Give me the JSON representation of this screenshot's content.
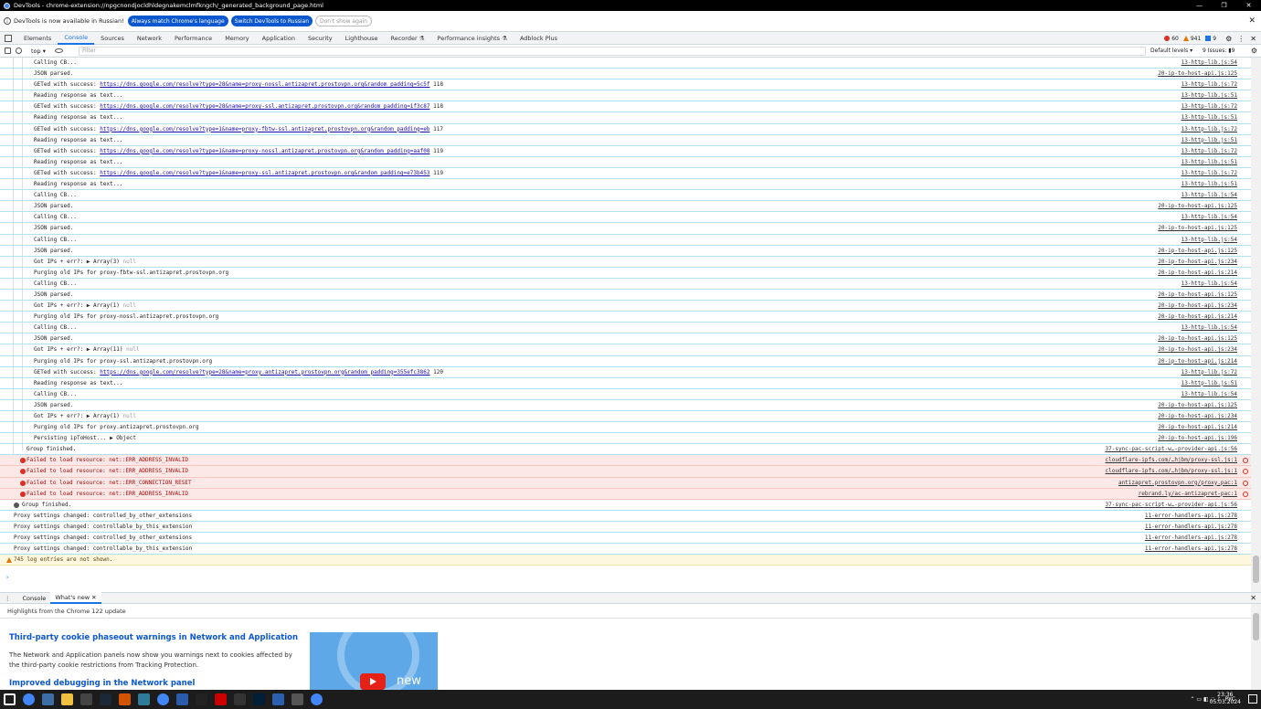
{
  "window": {
    "title": "DevTools - chrome-extension://npgcnondjocldhldegnakemclmfkngch/_generated_background_page.html",
    "min": "—",
    "max": "❐",
    "close": "✕"
  },
  "infobar": {
    "message": "DevTools is now available in Russian!",
    "btn_match": "Always match Chrome's language",
    "btn_switch": "Switch DevTools to Russian",
    "btn_dismiss": "Don't show again",
    "close": "✕"
  },
  "tabs": [
    "Elements",
    "Console",
    "Sources",
    "Network",
    "Performance",
    "Memory",
    "Application",
    "Security",
    "Lighthouse",
    "Recorder ⚗",
    "Performance insights ⚗",
    "Adblock Plus"
  ],
  "active_tab": "Console",
  "status": {
    "errors": "60",
    "warnings": "941",
    "info": "9"
  },
  "toolbar": {
    "context": "top ▾",
    "filter_placeholder": "Filter",
    "levels": "Default levels ▾",
    "issues": "9 Issues: ▮9"
  },
  "console_rows": [
    {
      "indent": 37,
      "msg": "Calling CB...",
      "src": "13-http-lib.js:54"
    },
    {
      "indent": 37,
      "msg": "JSON parsed.",
      "src": "20-ip-to-host-api.js:125"
    },
    {
      "indent": 37,
      "msg": "GETed with success: ",
      "link": "https://dns.google.com/resolve?type=28&name=proxy-nossl.antizapret.prostovpn.org&random_padding=5c5f",
      "tail": " 118",
      "src": "13-http-lib.js:72"
    },
    {
      "indent": 37,
      "msg": "Reading response as text...",
      "src": "13-http-lib.js:51"
    },
    {
      "indent": 37,
      "msg": "GETed with success: ",
      "link": "https://dns.google.com/resolve?type=28&name=proxy-ssl.antizapret.prostovpn.org&random_padding=1f3c87",
      "tail": " 118",
      "src": "13-http-lib.js:72"
    },
    {
      "indent": 37,
      "msg": "Reading response as text...",
      "src": "13-http-lib.js:51"
    },
    {
      "indent": 37,
      "msg": "GETed with success: ",
      "link": "https://dns.google.com/resolve?type=1&name=proxy-fbtw-ssl.antizapret.prostovpn.org&random_padding=eb",
      "tail": " 117",
      "src": "13-http-lib.js:72"
    },
    {
      "indent": 37,
      "msg": "Reading response as text...",
      "src": "13-http-lib.js:51"
    },
    {
      "indent": 37,
      "msg": "GETed with success: ",
      "link": "https://dns.google.com/resolve?type=1&name=proxy-nossl.antizapret.prostovpn.org&random_padding=aaf08",
      "tail": " 119",
      "src": "13-http-lib.js:72"
    },
    {
      "indent": 37,
      "msg": "Reading response as text...",
      "src": "13-http-lib.js:51"
    },
    {
      "indent": 37,
      "msg": "GETed with success: ",
      "link": "https://dns.google.com/resolve?type=1&name=proxy-ssl.antizapret.prostovpn.org&random_padding=e73b453",
      "tail": " 119",
      "src": "13-http-lib.js:72"
    },
    {
      "indent": 37,
      "msg": "Reading response as text...",
      "src": "13-http-lib.js:51"
    },
    {
      "indent": 37,
      "msg": "Calling CB...",
      "src": "13-http-lib.js:54"
    },
    {
      "indent": 37,
      "msg": "JSON parsed.",
      "src": "20-ip-to-host-api.js:125"
    },
    {
      "indent": 37,
      "msg": "Calling CB...",
      "src": "13-http-lib.js:54"
    },
    {
      "indent": 37,
      "msg": "JSON parsed.",
      "src": "20-ip-to-host-api.js:125"
    },
    {
      "indent": 37,
      "msg": "Calling CB...",
      "src": "13-http-lib.js:54"
    },
    {
      "indent": 37,
      "msg": "JSON parsed.",
      "src": "20-ip-to-host-api.js:125"
    },
    {
      "indent": 37,
      "msg": "Got IPs + err?:  ▶ Array(3) ",
      "grey": "null",
      "src": "20-ip-to-host-api.js:234"
    },
    {
      "indent": 37,
      "msg": "Purging old IPs for proxy-fbtw-ssl.antizapret.prostovpn.org",
      "src": "20-ip-to-host-api.js:214"
    },
    {
      "indent": 37,
      "msg": "Calling CB...",
      "src": "13-http-lib.js:54"
    },
    {
      "indent": 37,
      "msg": "JSON parsed.",
      "src": "20-ip-to-host-api.js:125"
    },
    {
      "indent": 37,
      "msg": "Got IPs + err?:  ▶ Array(1) ",
      "grey": "null",
      "src": "20-ip-to-host-api.js:234"
    },
    {
      "indent": 37,
      "msg": "Purging old IPs for proxy-nossl.antizapret.prostovpn.org",
      "src": "20-ip-to-host-api.js:214"
    },
    {
      "indent": 37,
      "msg": "Calling CB...",
      "src": "13-http-lib.js:54"
    },
    {
      "indent": 37,
      "msg": "JSON parsed.",
      "src": "20-ip-to-host-api.js:125"
    },
    {
      "indent": 37,
      "msg": "Got IPs + err?:  ▶ Array(11) ",
      "grey": "null",
      "src": "20-ip-to-host-api.js:234"
    },
    {
      "indent": 37,
      "msg": "Purging old IPs for proxy-ssl.antizapret.prostovpn.org",
      "src": "20-ip-to-host-api.js:214"
    },
    {
      "indent": 37,
      "msg": "GETed with success: ",
      "link": "https://dns.google.com/resolve?type=28&name=proxy.antizapret.prostovpn.org&random_padding=355efc3862",
      "tail": " 120",
      "src": "13-http-lib.js:72"
    },
    {
      "indent": 37,
      "msg": "Reading response as text...",
      "src": "13-http-lib.js:51"
    },
    {
      "indent": 37,
      "msg": "Calling CB...",
      "src": "13-http-lib.js:54"
    },
    {
      "indent": 37,
      "msg": "JSON parsed.",
      "src": "20-ip-to-host-api.js:125"
    },
    {
      "indent": 37,
      "msg": "Got IPs + err?:  ▶ Array(1) ",
      "grey": "null",
      "src": "20-ip-to-host-api.js:234"
    },
    {
      "indent": 37,
      "msg": "Purging old IPs for proxy.antizapret.prostovpn.org",
      "src": "20-ip-to-host-api.js:214"
    },
    {
      "indent": 37,
      "msg": "Persisting ipToHost...  ▶ Object",
      "src": "20-ip-to-host-api.js:196"
    },
    {
      "indent": 29,
      "msg": "Group finished.",
      "src": "37-sync-pac-script-w…-provider-api.js:56"
    },
    {
      "indent": 29,
      "type": "error",
      "msg": "Failed to load resource: net::ERR_ADDRESS_INVALID",
      "src": "cloudflare-ipfs.com/…hjbm/proxy-ssl.js:1"
    },
    {
      "indent": 29,
      "type": "error",
      "msg": "Failed to load resource: net::ERR_ADDRESS_INVALID",
      "src": "cloudflare-ipfs.com/…hjbm/proxy-ssl.js:1"
    },
    {
      "indent": 29,
      "type": "error",
      "msg": "Failed to load resource: net::ERR_CONNECTION_RESET",
      "src": "antizapret.prostovpn.org/proxy.pac:1"
    },
    {
      "indent": 29,
      "type": "error",
      "msg": "Failed to load resource: net::ERR_ADDRESS_INVALID",
      "src": "rebrand.ly/ac-antizapret-pac:1"
    },
    {
      "indent": 24,
      "type": "group",
      "msg": "Group finished.",
      "src": "37-sync-pac-script-w…-provider-api.js:56"
    },
    {
      "indent": 15,
      "msg": "Proxy settings changed: controlled_by_other_extensions",
      "src": "11-error-handlers-api.js:278"
    },
    {
      "indent": 15,
      "msg": "Proxy settings changed: controllable_by_this_extension",
      "src": "11-error-handlers-api.js:278"
    },
    {
      "indent": 15,
      "msg": "Proxy settings changed: controlled_by_other_extensions",
      "src": "11-error-handlers-api.js:278"
    },
    {
      "indent": 15,
      "msg": "Proxy settings changed: controllable_by_this_extension",
      "src": "11-error-handlers-api.js:278"
    },
    {
      "indent": 15,
      "type": "warn",
      "msg": "745 log entries are not shown.",
      "src": ""
    }
  ],
  "prompt": "›",
  "drawer": {
    "tabs": [
      "Console",
      "What's new"
    ],
    "active": "What's new",
    "close_tab": "✕",
    "subhead": "Highlights from the Chrome 122 update",
    "h1": "Third-party cookie phaseout warnings in Network and Application",
    "p1": "The Network and Application panels now show you warnings next to cookies affected by the third-party cookie restrictions from Tracking Protection.",
    "h2": "Improved debugging in the Network panel",
    "video_word": "new",
    "close": "✕"
  },
  "taskbar": {
    "lang": "РУС",
    "time": "23:36",
    "date": "05.03.2024",
    "icons": [
      "start-icon",
      "chrome-icon",
      "calculator-icon",
      "folder-icon",
      "media-icon",
      "steam-icon",
      "game-icon",
      "screen-icon",
      "chrome-icon",
      "app-icon",
      "antivirus-icon",
      "opera-icon",
      "obs-icon",
      "photoshop-icon",
      "explorer-icon",
      "terminal-icon",
      "chrome-icon"
    ]
  },
  "colors": {
    "accent": "#1a73e8",
    "error": "#d93025",
    "warning": "#e37400",
    "link": "#1a0dab"
  }
}
